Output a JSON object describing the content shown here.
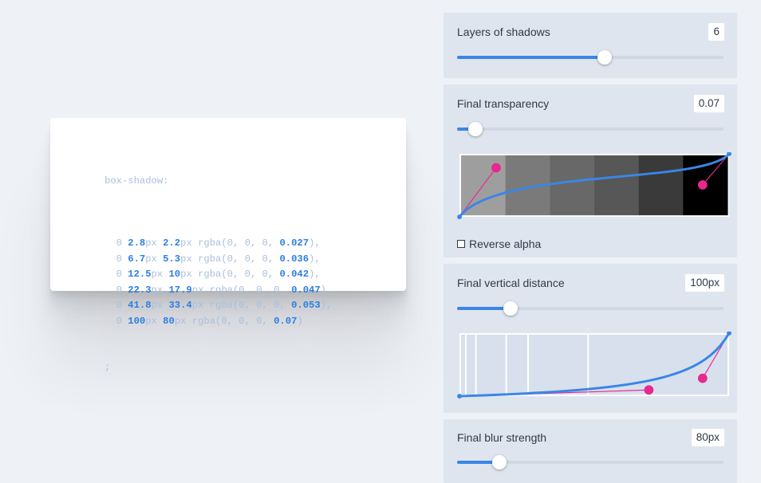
{
  "code": {
    "property": "box-shadow:",
    "layers": [
      {
        "x": "0",
        "y": "2.8",
        "blur": "2.2",
        "alpha": "0.027",
        "end": "),"
      },
      {
        "x": "0",
        "y": "6.7",
        "blur": "5.3",
        "alpha": "0.036",
        "end": "),"
      },
      {
        "x": "0",
        "y": "12.5",
        "blur": "10",
        "alpha": "0.042",
        "end": "),"
      },
      {
        "x": "0",
        "y": "22.3",
        "blur": "17.9",
        "alpha": "0.047",
        "end": "),"
      },
      {
        "x": "0",
        "y": "41.8",
        "blur": "33.4",
        "alpha": "0.053",
        "end": "),"
      },
      {
        "x": "0",
        "y": "100",
        "blur": "80",
        "alpha": "0.07",
        "end": ")"
      }
    ],
    "unit": "px",
    "rgba_prefix": "rgba(0, 0, 0, ",
    "terminator": ";"
  },
  "controls": {
    "layers": {
      "label": "Layers of shadows",
      "value": "6",
      "fraction": 0.555
    },
    "transparency": {
      "label": "Final transparency",
      "value": "0.07",
      "fraction": 0.07,
      "reverse_label": "Reverse alpha",
      "reverse_checked": false,
      "swatches": [
        "#9e9e9e",
        "#7a7a7a",
        "#686868",
        "#575757",
        "#3a3a3a",
        "#000000"
      ]
    },
    "distance": {
      "label": "Final vertical distance",
      "value": "100px",
      "fraction": 0.2
    },
    "blur": {
      "label": "Final blur strength",
      "value": "80px",
      "fraction": 0.16
    }
  },
  "colors": {
    "accent": "#3a86e6",
    "handle": "#e8288f",
    "panel": "#dfe5ee",
    "background": "#eef1f6"
  }
}
